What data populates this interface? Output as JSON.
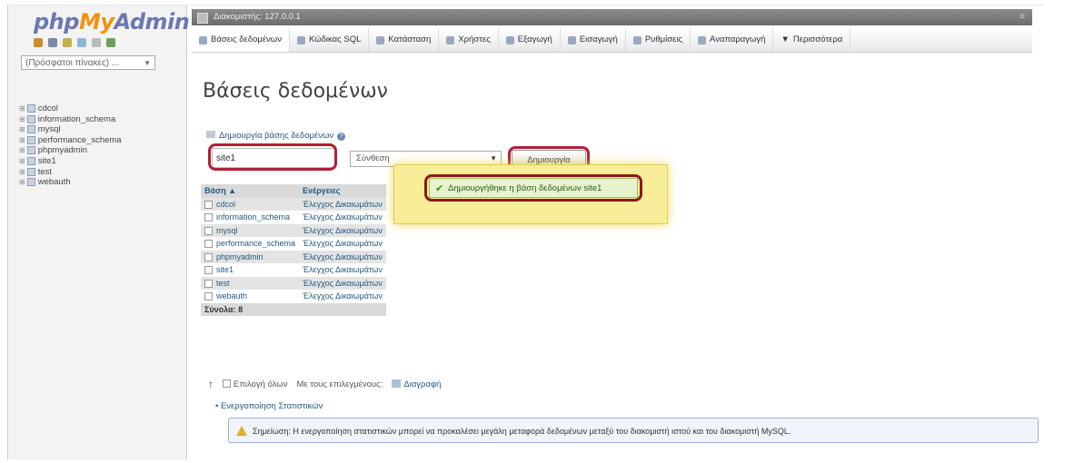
{
  "logo": {
    "php": "php",
    "my": "My",
    "admin": "Admin"
  },
  "left": {
    "recent_select": "(Πρόσφατοι πίνακες) ...",
    "databases": [
      "cdcol",
      "information_schema",
      "mysql",
      "performance_schema",
      "phpmyadmin",
      "site1",
      "test",
      "webauth"
    ]
  },
  "titlebar": {
    "text": "Διακομιστής: 127.0.0.1"
  },
  "tabs": [
    {
      "label": "Βάσεις δεδομένων",
      "icon": "database-icon"
    },
    {
      "label": "Κώδικας SQL",
      "icon": "sql-icon"
    },
    {
      "label": "Κατάσταση",
      "icon": "status-icon"
    },
    {
      "label": "Χρήστες",
      "icon": "users-icon"
    },
    {
      "label": "Εξαγωγή",
      "icon": "export-icon"
    },
    {
      "label": "Εισαγωγή",
      "icon": "import-icon"
    },
    {
      "label": "Ρυθμίσεις",
      "icon": "settings-icon"
    },
    {
      "label": "Αναπαραγωγή",
      "icon": "replication-icon"
    },
    {
      "label": "Περισσότερα",
      "icon": "more-chevron-icon"
    }
  ],
  "main": {
    "title": "Βάσεις δεδομένων",
    "create_label": "Δημιουργία βάσης δεδομένων",
    "dbname_value": "site1",
    "collation": "Σύνθεση",
    "create_button": "Δημιουργία",
    "success_message": "Δημιουργήθηκε η βάση δεδομένων site1"
  },
  "table": {
    "header_db": "Βάση",
    "header_sort": "▲",
    "header_action": "Ενέργειες",
    "rows": [
      {
        "name": "cdcol",
        "action": "Έλεγχος Δικαιωμάτων"
      },
      {
        "name": "information_schema",
        "action": "Έλεγχος Δικαιωμάτων"
      },
      {
        "name": "mysql",
        "action": "Έλεγχος Δικαιωμάτων"
      },
      {
        "name": "performance_schema",
        "action": "Έλεγχος Δικαιωμάτων"
      },
      {
        "name": "phpmyadmin",
        "action": "Έλεγχος Δικαιωμάτων"
      },
      {
        "name": "site1",
        "action": "Έλεγχος Δικαιωμάτων"
      },
      {
        "name": "test",
        "action": "Έλεγχος Δικαιωμάτων"
      },
      {
        "name": "webauth",
        "action": "Έλεγχος Δικαιωμάτων"
      }
    ],
    "total": "Σύνολα: 8"
  },
  "bulk": {
    "select_all": "Επιλογή όλων",
    "with_selected": "Με τους επιλεγμένους:",
    "delete": "Διαγραφή"
  },
  "stats": {
    "enable": "Ενεργοποίηση Στατιστικών"
  },
  "notice": {
    "text": "Σημείωση: Η ενεργοποίηση στατιστικών μπορεί να προκαλέσει μεγάλη μεταφορά δεδομένων μεταξύ του διακομιστή ιστού και του διακομιστή MySQL."
  },
  "colors": {
    "highlight": "#b02036",
    "popup": "#f8ee9a",
    "link": "#235a81",
    "logo_orange": "#f29111",
    "logo_blue": "#6c78af"
  }
}
